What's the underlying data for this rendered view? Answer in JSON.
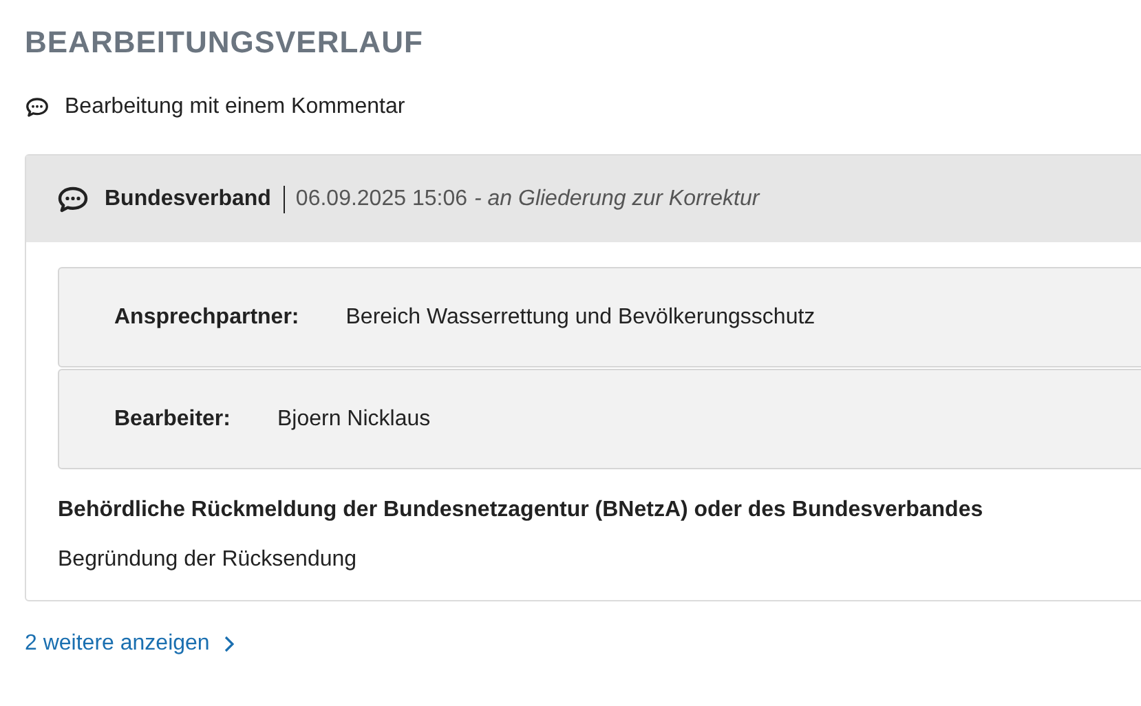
{
  "title": "BEARBEITUNGSVERLAUF",
  "summary": "Bearbeitung mit einem Kommentar",
  "entry": {
    "author": "Bundesverband",
    "timestamp": "06.09.2025 15:06",
    "note": "- an Gliederung zur Korrektur",
    "fields": [
      {
        "label": "Ansprechpartner:",
        "value": "Bereich Wasserrettung und Bevölkerungsschutz"
      },
      {
        "label": "Bearbeiter:",
        "value": "Bjoern Nicklaus"
      }
    ],
    "heading": "Behördliche Rückmeldung der Bundesnetzagentur (BNetzA) oder des Bundesverbandes",
    "text": "Begründung der Rücksendung"
  },
  "more_link": "2 weitere anzeigen"
}
